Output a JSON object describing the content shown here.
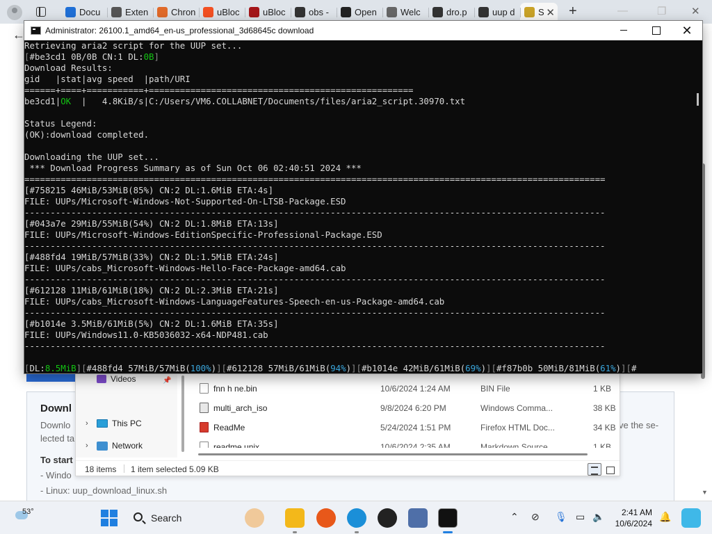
{
  "browser": {
    "tabs": [
      {
        "label": "Docu",
        "icon": "document-icon",
        "color": "#1f6fd6"
      },
      {
        "label": "Exten",
        "icon": "extensions-icon",
        "color": "#555555"
      },
      {
        "label": "Chron",
        "icon": "chrome-icon",
        "color": "#e06a2a"
      },
      {
        "label": "uBloc",
        "icon": "microsoft-store-icon",
        "color": "#f25022"
      },
      {
        "label": "uBloc",
        "icon": "ublock-icon",
        "color": "#a4161a"
      },
      {
        "label": "obs -",
        "icon": "search-icon",
        "color": "#333333"
      },
      {
        "label": "Open",
        "icon": "openai-icon",
        "color": "#222222"
      },
      {
        "label": "Welc",
        "icon": "page-icon",
        "color": "#666666"
      },
      {
        "label": "dro.p",
        "icon": "terminal-icon",
        "color": "#333333"
      },
      {
        "label": "uup d",
        "icon": "search-icon",
        "color": "#333333"
      },
      {
        "label": "S",
        "icon": "uup-icon",
        "color": "#c9a227"
      }
    ],
    "new_tab": "+",
    "tab_close": "✕"
  },
  "page": {
    "card_title": "Downl",
    "card_text_1": "Downlo",
    "card_text_2": "lected ta",
    "card_right_1": "ve the se-",
    "to_start": "To start",
    "list": [
      "- Windo",
      "- Linux: uup_download_linux.sh"
    ]
  },
  "console": {
    "title": "Administrator:  26100.1_amd64_en-us_professional_3d68645c download",
    "lines": [
      [
        {
          "t": "Retrieving aria2 script for the UUP set..."
        }
      ],
      [
        {
          "t": "[",
          "c": "c-gray"
        },
        {
          "t": "#be3cd1 0B/0B CN:1 DL:"
        },
        {
          "t": "0B",
          "c": "c-green"
        },
        {
          "t": "]",
          "c": "c-gray"
        }
      ],
      [
        {
          "t": "Download Results:"
        }
      ],
      [
        {
          "t": "gid   |stat|avg speed  |path/URI"
        }
      ],
      [
        {
          "t": "======+====+===========+==================================================="
        }
      ],
      [
        {
          "t": "be3cd1|"
        },
        {
          "t": "OK",
          "c": "c-green"
        },
        {
          "t": "  |   4.8KiB/s|C:/Users/VM6.COLLABNET/Documents/files/aria2_script.30970.txt"
        }
      ],
      [
        {
          "t": ""
        }
      ],
      [
        {
          "t": "Status Legend:"
        }
      ],
      [
        {
          "t": "(OK):download completed."
        }
      ],
      [
        {
          "t": ""
        }
      ],
      [
        {
          "t": "Downloading the UUP set..."
        }
      ],
      [
        {
          "t": " *** Download Progress Summary as of Sun Oct 06 02:40:51 2024 ***"
        }
      ],
      [
        {
          "t": "================================================================================================================"
        }
      ],
      [
        {
          "t": "[#758215 46MiB/53MiB(85%) CN:2 DL:1.6MiB ETA:4s]"
        }
      ],
      [
        {
          "t": "FILE: UUPs/Microsoft-Windows-Not-Supported-On-LTSB-Package.ESD"
        }
      ],
      [
        {
          "t": "----------------------------------------------------------------------------------------------------------------"
        }
      ],
      [
        {
          "t": "[#043a7e 29MiB/55MiB(54%) CN:2 DL:1.8MiB ETA:13s]"
        }
      ],
      [
        {
          "t": "FILE: UUPs/Microsoft-Windows-EditionSpecific-Professional-Package.ESD"
        }
      ],
      [
        {
          "t": "----------------------------------------------------------------------------------------------------------------"
        }
      ],
      [
        {
          "t": "[#488fd4 19MiB/57MiB(33%) CN:2 DL:1.5MiB ETA:24s]"
        }
      ],
      [
        {
          "t": "FILE: UUPs/cabs_Microsoft-Windows-Hello-Face-Package-amd64.cab"
        }
      ],
      [
        {
          "t": "----------------------------------------------------------------------------------------------------------------"
        }
      ],
      [
        {
          "t": "[#612128 11MiB/61MiB(18%) CN:2 DL:2.3MiB ETA:21s]"
        }
      ],
      [
        {
          "t": "FILE: UUPs/cabs_Microsoft-Windows-LanguageFeatures-Speech-en-us-Package-amd64.cab"
        }
      ],
      [
        {
          "t": "----------------------------------------------------------------------------------------------------------------"
        }
      ],
      [
        {
          "t": "[#b1014e 3.5MiB/61MiB(5%) CN:2 DL:1.6MiB ETA:35s]"
        }
      ],
      [
        {
          "t": "FILE: UUPs/Windows11.0-KB5036032-x64-NDP481.cab"
        }
      ],
      [
        {
          "t": "----------------------------------------------------------------------------------------------------------------"
        }
      ],
      [
        {
          "t": ""
        }
      ],
      [
        {
          "t": "[",
          "c": "c-gray"
        },
        {
          "t": "DL:"
        },
        {
          "t": "8.5MiB",
          "c": "c-green"
        },
        {
          "t": "][",
          "c": "c-gray"
        },
        {
          "t": "#488fd4 57MiB/57MiB("
        },
        {
          "t": "100%",
          "c": "c-cyan"
        },
        {
          "t": ")"
        },
        {
          "t": "][",
          "c": "c-gray"
        },
        {
          "t": "#612128 57MiB/61MiB("
        },
        {
          "t": "94%",
          "c": "c-cyan"
        },
        {
          "t": ")"
        },
        {
          "t": "][",
          "c": "c-gray"
        },
        {
          "t": "#b1014e 42MiB/61MiB("
        },
        {
          "t": "69%",
          "c": "c-cyan"
        },
        {
          "t": ")"
        },
        {
          "t": "][",
          "c": "c-gray"
        },
        {
          "t": "#f87b0b 50MiB/81MiB("
        },
        {
          "t": "61%",
          "c": "c-cyan"
        },
        {
          "t": ")"
        },
        {
          "t": "][",
          "c": "c-gray"
        },
        {
          "t": "#"
        }
      ]
    ]
  },
  "explorer": {
    "nav": [
      {
        "label": "Videos",
        "icon": "videos-icon"
      },
      {
        "label": "This PC",
        "icon": "this-pc-icon"
      },
      {
        "label": "Network",
        "icon": "network-icon"
      }
    ],
    "files": [
      {
        "name": "fnn h ne.bin",
        "date": "10/6/2024 1:24 AM",
        "type": "BIN File",
        "size": "1 KB",
        "icon": "file-icon"
      },
      {
        "name": "multi_arch_iso",
        "date": "9/8/2024 6:20 PM",
        "type": "Windows Comma...",
        "size": "38 KB",
        "icon": "cmd-file-icon"
      },
      {
        "name": "ReadMe",
        "date": "5/24/2024 1:51 PM",
        "type": "Firefox HTML Doc...",
        "size": "34 KB",
        "icon": "html-file-icon"
      },
      {
        "name": "readme.unix",
        "date": "10/6/2024 2:35 AM",
        "type": "Markdown Source",
        "size": "1 KB",
        "icon": "file-icon"
      }
    ],
    "status_items": "18 items",
    "status_selected": "1 item selected  5.09 KB"
  },
  "taskbar": {
    "temperature": "53°",
    "search_label": "Search",
    "time": "2:41 AM",
    "date": "10/6/2024",
    "accent": "#1f7fe0"
  }
}
